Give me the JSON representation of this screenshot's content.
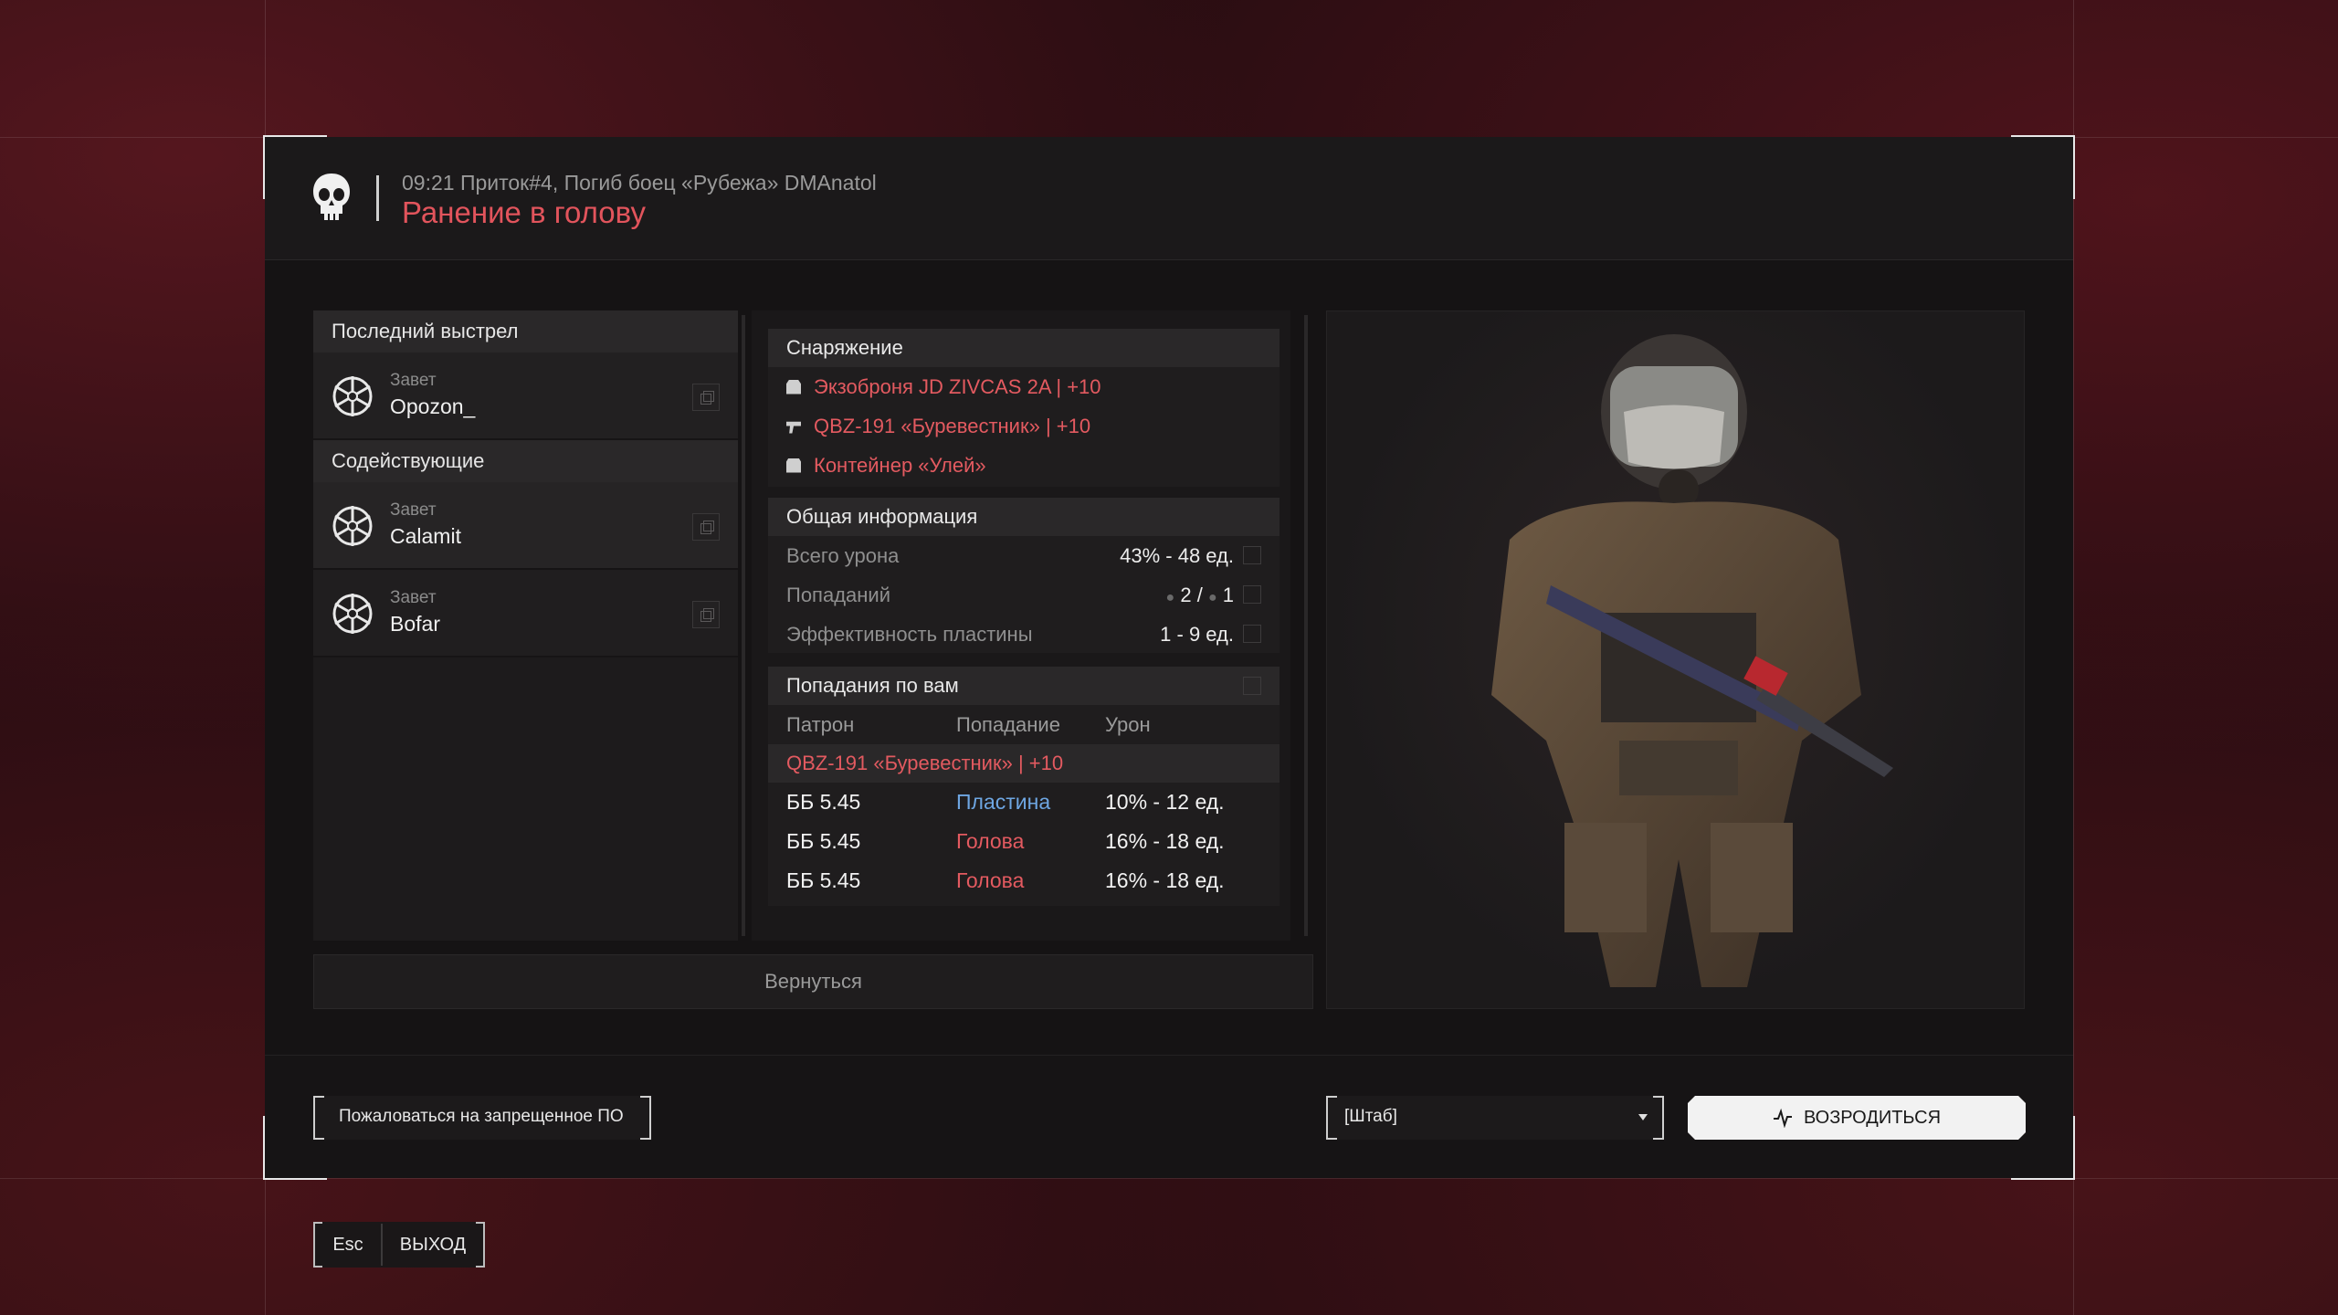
{
  "header": {
    "event_line": "09:21 Приток#4, Погиб боец «Рубежа» DMAnatol",
    "death_cause": "Ранение в голову"
  },
  "left_panel": {
    "last_shot_title": "Последний выстрел",
    "killer": {
      "clan": "Завет",
      "name": "Opozon_"
    },
    "assists_title": "Содействующие",
    "assists": [
      {
        "clan": "Завет",
        "name": "Calamit"
      },
      {
        "clan": "Завет",
        "name": "Bofar"
      }
    ]
  },
  "equipment": {
    "title": "Снаряжение",
    "items": [
      {
        "icon": "armor-icon",
        "label": "Экзоброня JD ZIVCAS 2A  |  +10"
      },
      {
        "icon": "rifle-icon",
        "label": "QBZ-191 «Буревестник»  |  +10"
      },
      {
        "icon": "container-icon",
        "label": "Контейнер «Улей»"
      }
    ]
  },
  "general_info": {
    "title": "Общая информация",
    "rows": [
      {
        "label": "Всего урона",
        "value": "43% - 48 ед."
      },
      {
        "label": "Попаданий",
        "value_a": "2",
        "sep": "/",
        "value_b": "1"
      },
      {
        "label": "Эффективность пластины",
        "value": "1 - 9 ед."
      }
    ]
  },
  "hits_on_you": {
    "title": "Попадания по вам",
    "columns": [
      "Патрон",
      "Попадание",
      "Урон"
    ],
    "weapon": "QBZ-191 «Буревестник»  |  +10",
    "rows": [
      {
        "ammo": "ББ 5.45",
        "hit": "Пластина",
        "hit_type": "plate",
        "damage": "10% - 12 ед."
      },
      {
        "ammo": "ББ 5.45",
        "hit": "Голова",
        "hit_type": "head",
        "damage": "16% - 18 ед."
      },
      {
        "ammo": "ББ 5.45",
        "hit": "Голова",
        "hit_type": "head",
        "damage": "16% - 18 ед."
      }
    ]
  },
  "back_button": "Вернуться",
  "footer": {
    "report_button": "Пожаловаться на запрещенное ПО",
    "spawn_select": "[Штаб]",
    "respawn_button": "ВОЗРОДИТЬСЯ"
  },
  "exit": {
    "key": "Esc",
    "label": "ВЫХОД"
  },
  "colors": {
    "accent_red": "#e35a60",
    "plate_blue": "#6ea6e2",
    "panel_bg": "#151314"
  }
}
